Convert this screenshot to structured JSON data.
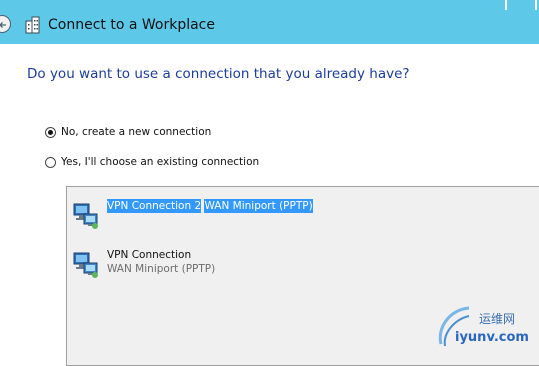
{
  "window": {
    "title": "Connect to a Workplace"
  },
  "heading": "Do you want to use a connection that you already have?",
  "options": [
    {
      "label": "No, create a new connection",
      "selected": true
    },
    {
      "label": "Yes, I'll choose an existing connection",
      "selected": false
    }
  ],
  "connections": [
    {
      "name": "VPN Connection 2",
      "device": "WAN Miniport (PPTP)",
      "selected": true
    },
    {
      "name": "VPN Connection",
      "device": "WAN Miniport (PPTP)",
      "selected": false
    }
  ],
  "watermark": {
    "cn_text": "运维网",
    "url_text": "iyunv.com"
  },
  "icons": {
    "back": "back-arrow-icon",
    "title": "workplace-icon",
    "connection": "network-connection-icon"
  },
  "colors": {
    "titlebar": "#5ec8e8",
    "heading": "#1c3d99",
    "selection": "#3399ff"
  }
}
